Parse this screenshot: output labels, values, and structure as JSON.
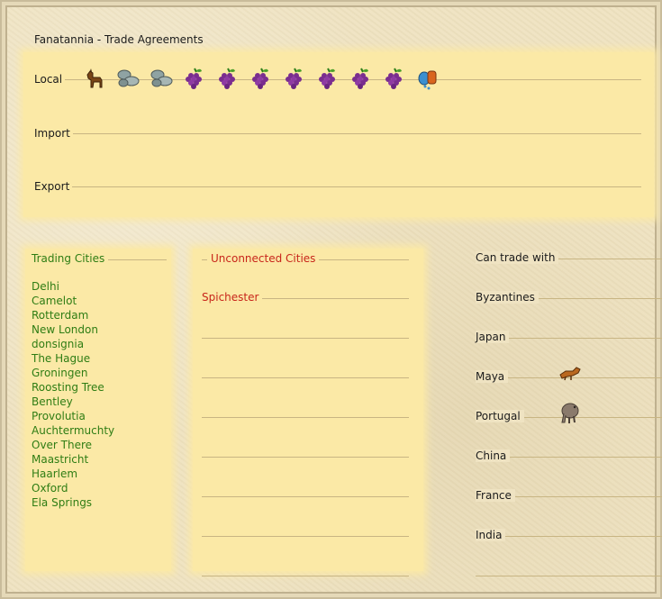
{
  "window": {
    "title": "Fanatannia - Trade Agreements"
  },
  "goods": {
    "local_label": "Local",
    "import_label": "Import",
    "export_label": "Export",
    "local_items": [
      {
        "icon": "horse-icon"
      },
      {
        "icon": "stone-icon"
      },
      {
        "icon": "stone-icon"
      },
      {
        "icon": "grapes-icon"
      },
      {
        "icon": "grapes-icon"
      },
      {
        "icon": "grapes-icon"
      },
      {
        "icon": "grapes-icon"
      },
      {
        "icon": "grapes-icon"
      },
      {
        "icon": "grapes-icon"
      },
      {
        "icon": "grapes-icon"
      },
      {
        "icon": "dye-icon"
      }
    ]
  },
  "trading_cities": {
    "header": "Trading Cities",
    "cities": [
      "Delhi",
      "Camelot",
      "Rotterdam",
      "New London",
      "donsignia",
      "The Hague",
      "Groningen",
      "Roosting Tree",
      "Bentley",
      "Provolutia",
      "Auchtermuchty",
      "Over There",
      "Maastricht",
      "Haarlem",
      "Oxford",
      "Ela Springs"
    ]
  },
  "unconnected_cities": {
    "header": "Unconnected Cities",
    "cities": [
      "Spichester"
    ]
  },
  "can_trade_with": {
    "header": "Can trade with",
    "civs": [
      {
        "name": "Byzantines",
        "icon": ""
      },
      {
        "name": "Japan",
        "icon": ""
      },
      {
        "name": "Maya",
        "icon": "fox-icon"
      },
      {
        "name": "Portugal",
        "icon": "elephant-icon"
      },
      {
        "name": "China",
        "icon": ""
      },
      {
        "name": "France",
        "icon": ""
      },
      {
        "name": "India",
        "icon": ""
      }
    ]
  },
  "colors": {
    "panel": "#fbe9a6",
    "parchment": "#efe3c2",
    "city_green": "#2f7d14",
    "header_red": "#c8261b",
    "rule": "#c8b583"
  }
}
